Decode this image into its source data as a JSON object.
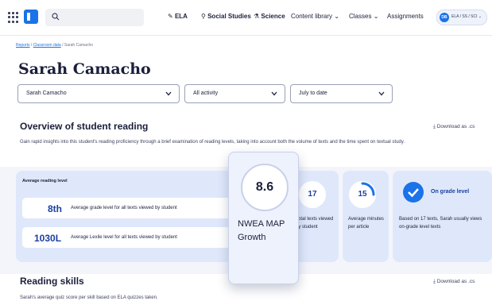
{
  "topnav": {
    "ela": "ELA",
    "social_studies": "Social Studies",
    "science": "Science",
    "content_library": "Content library",
    "classes": "Classes",
    "assignments": "Assignments",
    "avatar_initials": "DB",
    "subject_switch": "ELA / SS / SCI"
  },
  "breadcrumb": {
    "reports": "Reports",
    "sep": "/",
    "classroom_data": "Classroom data",
    "current": "Sarah Camacho"
  },
  "page": {
    "title": "Sarah Camacho"
  },
  "filters": {
    "student": "Sarah Camacho",
    "activity": "All activity",
    "range": "July to date"
  },
  "overview": {
    "heading": "Overview of student reading",
    "description": "Gain rapid insights into this student's reading proficiency through a brief examination of reading levels, taking into account both the volume of texts and the time spent on textual study.",
    "download": "Download as .cs"
  },
  "avg_card": {
    "heading": "Average reading level",
    "grade_value": "8th",
    "grade_label": "Average grade level for all texts viewed by student",
    "lexile_value": "1030L",
    "lexile_label": "Average Lexile level for all texts viewed by student"
  },
  "texts_card": {
    "value": "17",
    "label": "Total texts viewed by student"
  },
  "minutes_card": {
    "value": "15",
    "label": "Average minutes per article",
    "progress": 0.25
  },
  "grade_card": {
    "heading": "On grade level",
    "label": "Based on 17 texts, Sarah usually views on-grade level texts"
  },
  "tooltip": {
    "value": "8.6",
    "label": "NWEA MAP Growth"
  },
  "skills": {
    "heading": "Reading skills",
    "download": "Download as .cs",
    "caption": "Sarah's average quiz score per skill based on ELA quizzes taken."
  },
  "colors": {
    "accent": "#1a73e8",
    "card": "#dfe8fb",
    "band": "#f3f5fb"
  }
}
